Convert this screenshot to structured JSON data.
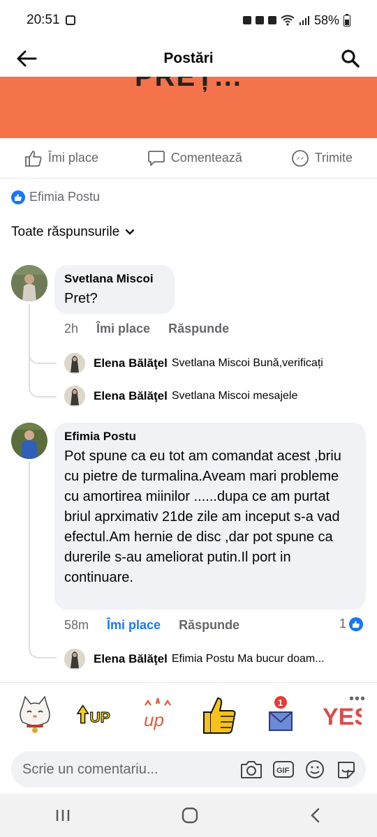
{
  "status": {
    "time": "20:51",
    "battery": "58%"
  },
  "header": {
    "title": "Postări"
  },
  "banner": {
    "text": "PREȚ..."
  },
  "actions": {
    "like": "Îmi place",
    "comment": "Comentează",
    "share": "Trimite"
  },
  "reactor": {
    "name": "Efimia Postu"
  },
  "filter": {
    "label": "Toate răspunsurile"
  },
  "comments": [
    {
      "author": "Svetlana Miscoi",
      "text": "Pret?",
      "time": "2h",
      "like": "Îmi place",
      "reply": "Răspunde",
      "replies": [
        {
          "author": "Elena Bălăţel",
          "text": "Svetlana Miscoi Bună,verificați"
        },
        {
          "author": "Elena Bălăţel",
          "text": "Svetlana Miscoi mesajele"
        }
      ]
    },
    {
      "author": "Efimia Postu",
      "text": "Pot spune ca eu tot am comandat acest ,briu cu pietre de turmalina.Aveam mari probleme cu amortirea miinilor ......dupa ce am purtat briul aprximativ 21de zile am inceput s-a vad efectul.Am hernie de disc ,dar pot spune ca durerile s-au ameliorat putin.Il port in continuare.",
      "time": "58m",
      "like": "Îmi place",
      "reply": "Răspunde",
      "reactions": "1",
      "replies": [
        {
          "author": "Elena Bălăţel",
          "text": "Efimia Postu Ma bucur doam..."
        }
      ]
    }
  ],
  "stickers": [
    "cat-sticker",
    "up-arrow-sticker",
    "up-sparkle-sticker",
    "thumbs-up-sticker",
    "mail-sticker",
    "yes-sticker"
  ],
  "input": {
    "placeholder": "Scrie un comentariu..."
  },
  "colors": {
    "accent": "#1877f2",
    "banner": "#f5734a",
    "bubble": "#f0f2f5",
    "muted": "#65676b"
  }
}
